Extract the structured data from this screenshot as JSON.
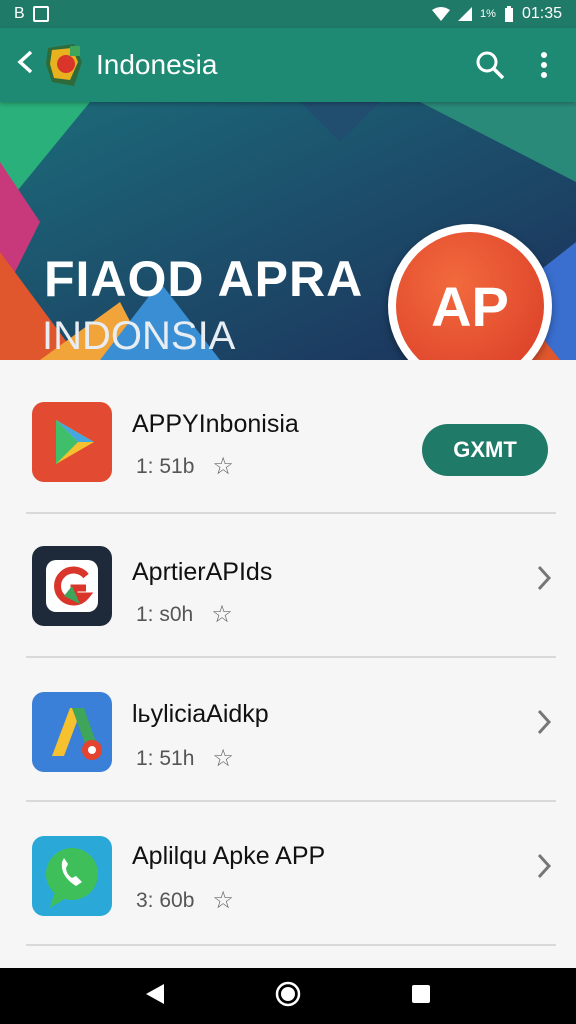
{
  "status_bar": {
    "left_a": "B",
    "left_b": "M",
    "battery": "1%",
    "time": "01:35"
  },
  "app_bar": {
    "title": "Indonesia",
    "back_icon": "back-arrow-icon",
    "search_icon": "search-icon",
    "menu_icon": "more-vert-icon"
  },
  "banner": {
    "title": "FIAOD APRA",
    "subtitle": "INDONSIA",
    "badge_text": "AP",
    "dots": [
      "#f08a2a",
      "#e8c24a",
      "#3a6fd0"
    ]
  },
  "apps": [
    {
      "name": "APPYInbonisia",
      "meta": "1: 51b",
      "action": "GXMT",
      "icon": "play-store-icon"
    },
    {
      "name": "AprtierAPIds",
      "meta": "1: s0h",
      "icon": "g-shield-icon"
    },
    {
      "name": "lьylicіaAidkp",
      "meta": "1: 51h",
      "icon": "ads-logo-icon"
    },
    {
      "name": "Aplilqu Apke APP",
      "meta": "3: 60b",
      "icon": "phone-chat-icon"
    }
  ],
  "colors": {
    "primary": "#1f8a73",
    "primary_dark": "#1f7a68",
    "accent": "#d93a26"
  }
}
